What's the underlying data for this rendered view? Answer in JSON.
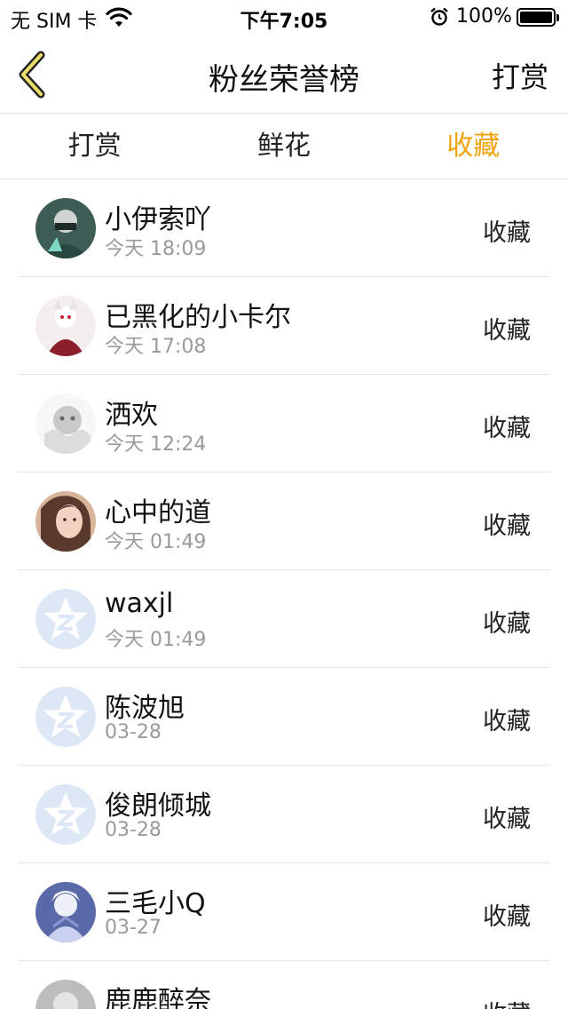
{
  "status_bar": {
    "carrier": "无 SIM 卡",
    "time": "下午7:05",
    "battery": "100%"
  },
  "nav": {
    "title": "粉丝荣誉榜",
    "right_label": "打赏",
    "back_icon": "chevron-left-icon",
    "accent_color": "#f0a30a"
  },
  "tabs": [
    {
      "label": "打赏",
      "active": false
    },
    {
      "label": "鲜花",
      "active": false
    },
    {
      "label": "收藏",
      "active": true
    }
  ],
  "fans": [
    {
      "name": "小伊索吖",
      "date": "今天 18:09",
      "action": "收藏",
      "avatar": "photo-masked-figure"
    },
    {
      "name": "已黑化的小卡尔",
      "date": "今天 17:08",
      "action": "收藏",
      "avatar": "photo-anime-red"
    },
    {
      "name": "洒欢",
      "date": "今天 12:24",
      "action": "收藏",
      "avatar": "photo-cartoon-grey"
    },
    {
      "name": "心中的道",
      "date": "今天 01:49",
      "action": "收藏",
      "avatar": "photo-portrait"
    },
    {
      "name": "waxjl",
      "date": "今天 01:49",
      "action": "收藏",
      "avatar": "default-star-avatar"
    },
    {
      "name": "陈波旭",
      "date": "03-28",
      "action": "收藏",
      "avatar": "default-star-avatar"
    },
    {
      "name": "俊朗倾城",
      "date": "03-28",
      "action": "收藏",
      "avatar": "default-star-avatar"
    },
    {
      "name": "三毛小Q",
      "date": "03-27",
      "action": "收藏",
      "avatar": "photo-anime-white"
    },
    {
      "name": "鹿鹿醉奈",
      "date": "",
      "action": "收藏",
      "avatar": "photo-grey"
    }
  ]
}
